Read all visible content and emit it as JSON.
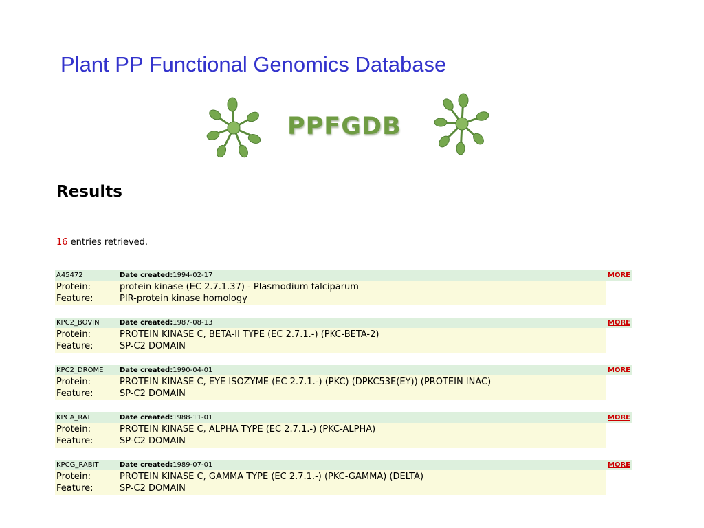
{
  "page_title": "Plant PP Functional Genomics Database",
  "banner": {
    "text": "PPFGDB",
    "left_icon": "plant-icon",
    "right_icon": "plant-icon",
    "text_color": "#6f9c43"
  },
  "results": {
    "heading": "Results",
    "count": "16",
    "count_suffix": " entries retrieved.",
    "date_label": "Date created:",
    "protein_label": "Protein:",
    "feature_label": "Feature:",
    "more_label": "MORE",
    "entries": [
      {
        "accession": "A45472",
        "date": "1994-02-17",
        "protein": "protein kinase (EC 2.7.1.37) - Plasmodium falciparum",
        "feature": "PIR-protein kinase homology"
      },
      {
        "accession": "KPC2_BOVIN",
        "date": "1987-08-13",
        "protein": "PROTEIN KINASE C, BETA-II TYPE (EC 2.7.1.-) (PKC-BETA-2)",
        "feature": "SP-C2 DOMAIN"
      },
      {
        "accession": "KPC2_DROME",
        "date": "1990-04-01",
        "protein": "PROTEIN KINASE C, EYE ISOZYME (EC 2.7.1.-) (PKC) (DPKC53E(EY)) (PROTEIN INAC)",
        "feature": "SP-C2 DOMAIN"
      },
      {
        "accession": "KPCA_RAT",
        "date": "1988-11-01",
        "protein": "PROTEIN KINASE C, ALPHA TYPE (EC 2.7.1.-) (PKC-ALPHA)",
        "feature": "SP-C2 DOMAIN"
      },
      {
        "accession": "KPCG_RABIT",
        "date": "1989-07-01",
        "protein": "PROTEIN KINASE C, GAMMA TYPE (EC 2.7.1.-) (PKC-GAMMA) (DELTA)",
        "feature": "SP-C2 DOMAIN"
      }
    ]
  },
  "colors": {
    "title": "#3333cc",
    "count": "#cc0000",
    "more_link": "#cc0000",
    "header_row_bg": "#ddf0dd",
    "body_row_bg": "#fafadc"
  }
}
